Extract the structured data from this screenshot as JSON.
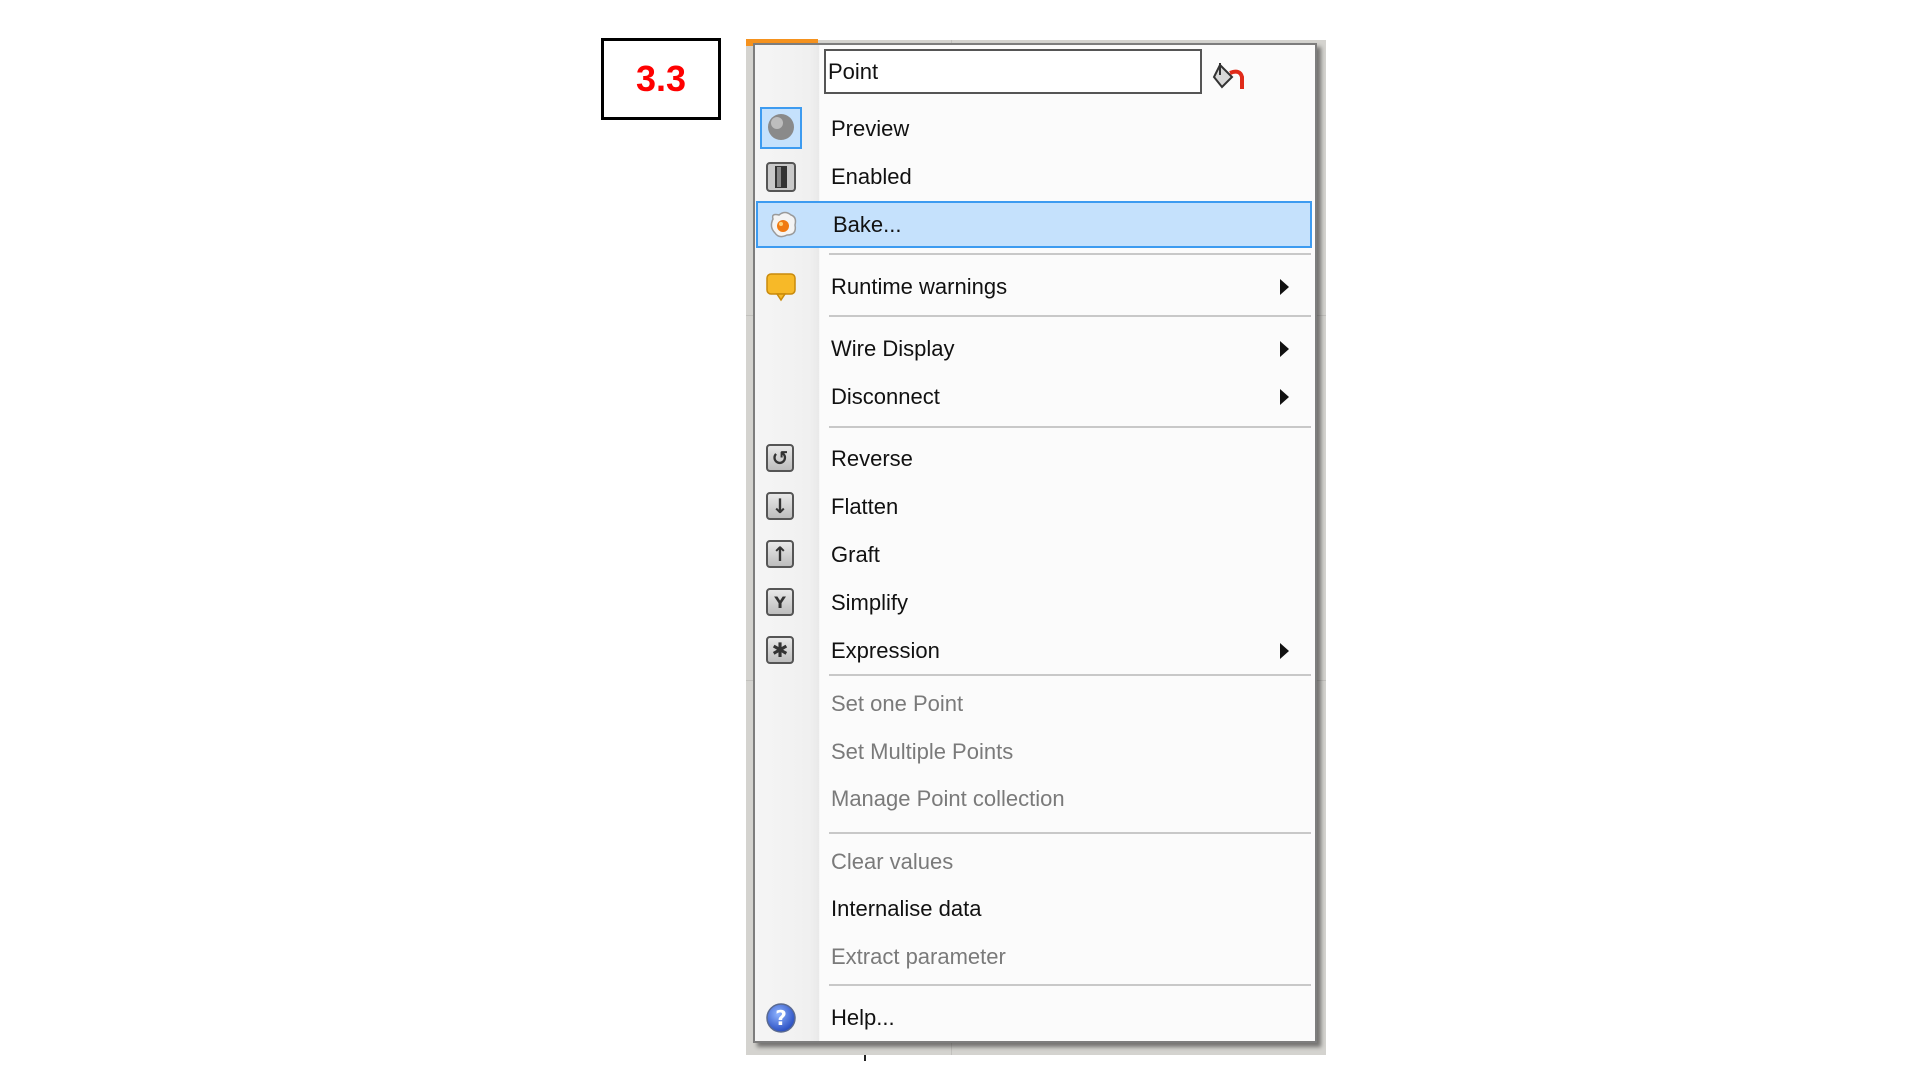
{
  "slide_label": "3.3",
  "menu": {
    "name_field": {
      "value": "Point",
      "placeholder": ""
    },
    "paint_icon": "paint-bucket-icon",
    "items": [
      {
        "label": "Preview",
        "icon": "preview-sphere-icon",
        "enabled": true,
        "checked": true
      },
      {
        "label": "Enabled",
        "icon": "enabled-toggle-icon",
        "enabled": true
      },
      {
        "label": "Bake...",
        "icon": "bake-egg-icon",
        "enabled": true,
        "highlighted": true
      },
      {
        "label": "Runtime warnings",
        "icon": "warning-balloon-icon",
        "enabled": true,
        "submenu": true
      },
      {
        "label": "Wire Display",
        "enabled": true,
        "submenu": true
      },
      {
        "label": "Disconnect",
        "enabled": true,
        "submenu": true
      },
      {
        "label": "Reverse",
        "icon": "reverse-icon",
        "enabled": true
      },
      {
        "label": "Flatten",
        "icon": "flatten-arrow-down-icon",
        "enabled": true
      },
      {
        "label": "Graft",
        "icon": "graft-arrow-up-icon",
        "enabled": true
      },
      {
        "label": "Simplify",
        "icon": "simplify-icon",
        "enabled": true
      },
      {
        "label": "Expression",
        "icon": "expression-asterisk-icon",
        "enabled": true,
        "submenu": true
      },
      {
        "label": "Set one Point",
        "enabled": false
      },
      {
        "label": "Set Multiple Points",
        "enabled": false
      },
      {
        "label": "Manage Point collection",
        "enabled": false
      },
      {
        "label": "Clear values",
        "enabled": false
      },
      {
        "label": "Internalise data",
        "enabled": true
      },
      {
        "label": "Extract parameter",
        "enabled": false
      },
      {
        "label": "Help...",
        "icon": "help-question-icon",
        "enabled": true
      }
    ]
  },
  "colors": {
    "highlight_fill": "#c5e1fc",
    "highlight_border": "#3d9bf0",
    "label_red": "#ff0000",
    "disabled_text": "#7a7a7a",
    "accent_orange": "#f5921e"
  }
}
